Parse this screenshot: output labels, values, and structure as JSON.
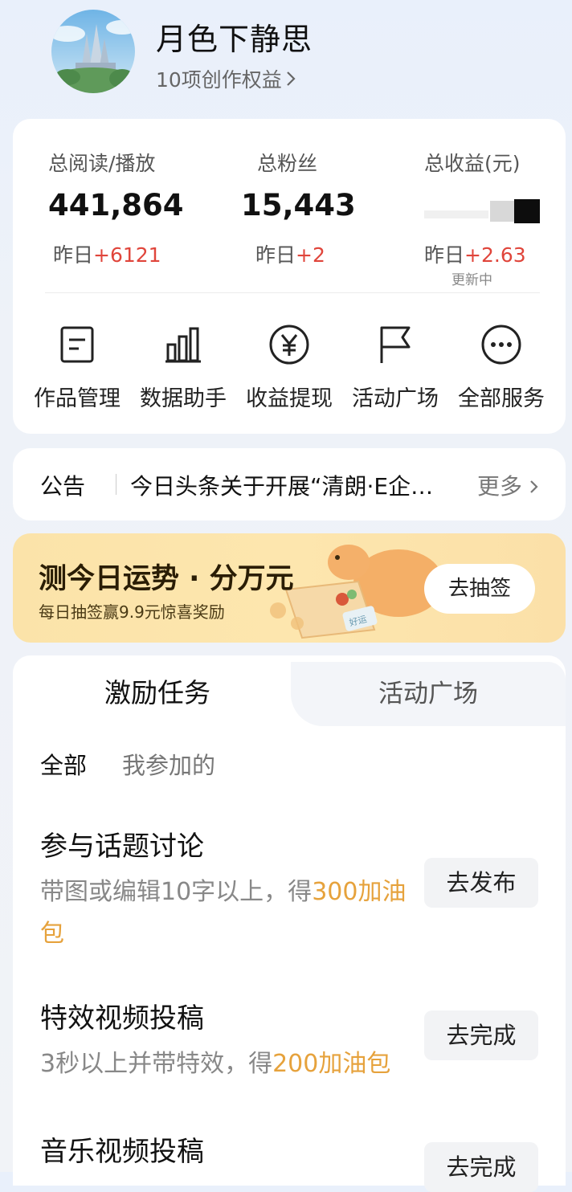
{
  "profile": {
    "username": "月色下静思",
    "rights": "10项创作权益",
    "rights_chevron": "chevron-right-icon"
  },
  "stats": [
    {
      "label": "总阅读/播放",
      "value": "441,864",
      "yesterday_prefix": "昨日",
      "yesterday_inc": "+6121"
    },
    {
      "label": "总粉丝",
      "value": "15,443",
      "yesterday_prefix": "昨日",
      "yesterday_inc": "+2"
    },
    {
      "label": "总收益(元)",
      "value": "",
      "yesterday_prefix": "昨日",
      "yesterday_inc": "+2.63",
      "status": "更新中"
    }
  ],
  "services": [
    {
      "label": "作品管理",
      "icon": "document-icon"
    },
    {
      "label": "数据助手",
      "icon": "bar-chart-icon"
    },
    {
      "label": "收益提现",
      "icon": "yuan-icon"
    },
    {
      "label": "活动广场",
      "icon": "flag-icon"
    },
    {
      "label": "全部服务",
      "icon": "more-dots-icon"
    }
  ],
  "notice": {
    "tag": "公告",
    "text": "今日头条关于开展“清朗·E企…",
    "more": "更多"
  },
  "banner": {
    "title": "测今日运势 · 分万元",
    "subtitle": "每日抽签赢9.9元惊喜奖励",
    "button": "去抽签",
    "badge": "好运"
  },
  "tasks": {
    "tabs": [
      "激励任务",
      "活动广场"
    ],
    "filters": [
      "全部",
      "我参加的"
    ],
    "items": [
      {
        "title": "参与话题讨论",
        "desc": "带图或编辑10字以上，得",
        "reward": "300加油包",
        "button": "去发布"
      },
      {
        "title": "特效视频投稿",
        "desc": "3秒以上并带特效，得",
        "reward": "200加油包",
        "button": "去完成"
      },
      {
        "title": "音乐视频投稿",
        "desc": "",
        "reward": "",
        "button": "去完成"
      }
    ]
  },
  "colors": {
    "accent_red": "#e0453b",
    "reward_orange": "#e6a23c",
    "banner_bg": "#fde6ae"
  }
}
